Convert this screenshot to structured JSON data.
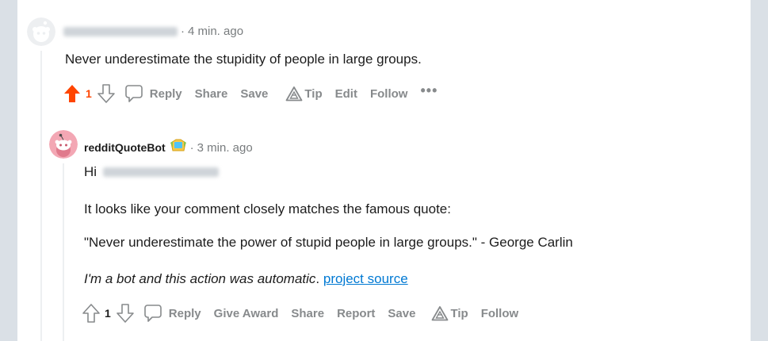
{
  "colors": {
    "background": "#dae0e6",
    "panel": "#ffffff",
    "upvote_active": "#ff4500",
    "action_text": "#878a8c",
    "link": "#0079d3"
  },
  "comment1": {
    "time": "4 min. ago",
    "body": "Never underestimate the stupidity of people in large groups.",
    "upvote_state": "upvoted",
    "score": "1",
    "actions": {
      "reply": "Reply",
      "share": "Share",
      "save": "Save",
      "tip": "Tip",
      "edit": "Edit",
      "follow": "Follow",
      "more": "•••"
    }
  },
  "comment2": {
    "author": "redditQuoteBot",
    "time": "3 min. ago",
    "greeting": "Hi",
    "line1": "It looks like your comment closely matches the famous quote:",
    "quote": "\"Never underestimate the power of stupid people in large groups.\" - George Carlin",
    "bot_note": "I'm a bot and this action was automatic",
    "bot_note_end": ".",
    "link_text": "project source",
    "score": "1",
    "actions": {
      "reply": "Reply",
      "give_award": "Give Award",
      "share": "Share",
      "report": "Report",
      "save": "Save",
      "tip": "Tip",
      "follow": "Follow"
    }
  }
}
